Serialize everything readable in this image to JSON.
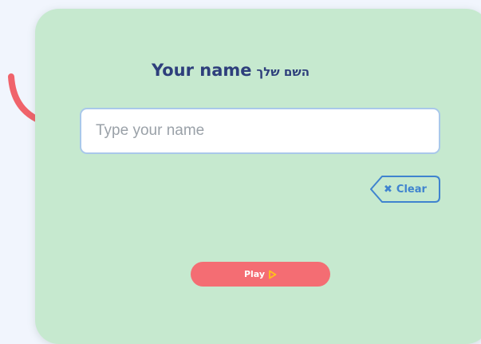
{
  "form": {
    "title_en": "Your name",
    "title_he": "השם שלך",
    "name_input": {
      "value": "",
      "placeholder": "Type your name"
    },
    "clear_label": "Clear",
    "clear_icon": "x-icon",
    "play_label": "Play",
    "play_icon": "play-triangle-icon"
  },
  "decoration": {
    "arrow_icon": "curved-arrow-pointer-icon"
  },
  "colors": {
    "page_background": "#f1f5fd",
    "card_background": "#c6e9cf",
    "title": "#2e3f7c",
    "input_border": "#a9c8ea",
    "clear_accent": "#3f83cf",
    "play_button": "#f46d73",
    "play_icon": "#ffc21a",
    "arrow": "#f0636b"
  }
}
